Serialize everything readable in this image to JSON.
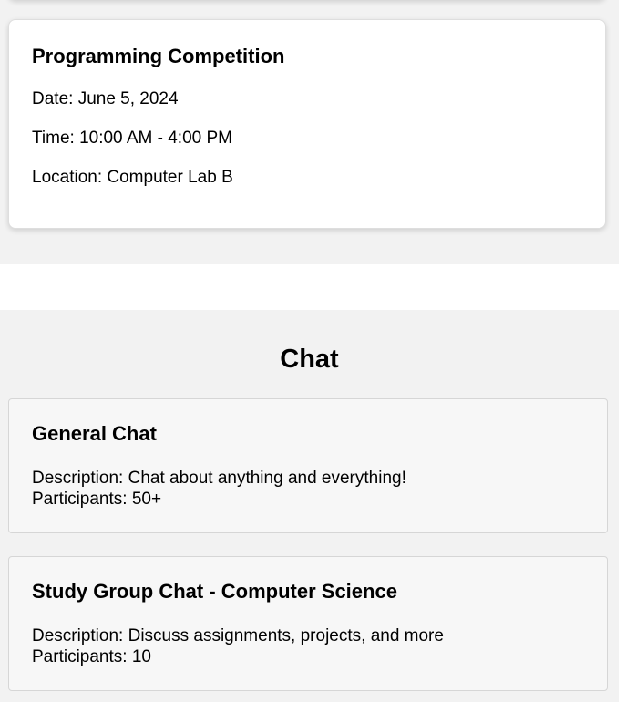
{
  "event": {
    "title": "Programming Competition",
    "date": "Date: June 5, 2024",
    "time": "Time: 10:00 AM - 4:00 PM",
    "location": "Location: Computer Lab B"
  },
  "chat": {
    "heading": "Chat",
    "rooms": [
      {
        "title": "General Chat",
        "description": "Description: Chat about anything and everything!",
        "participants": "Participants: 50+"
      },
      {
        "title": "Study Group Chat - Computer Science",
        "description": "Description: Discuss assignments, projects, and more",
        "participants": "Participants: 10"
      }
    ]
  },
  "colors": {
    "section_bg": "#f2f2f2",
    "card_bg": "#ffffff",
    "chat_card_bg": "#f7f7f7"
  }
}
